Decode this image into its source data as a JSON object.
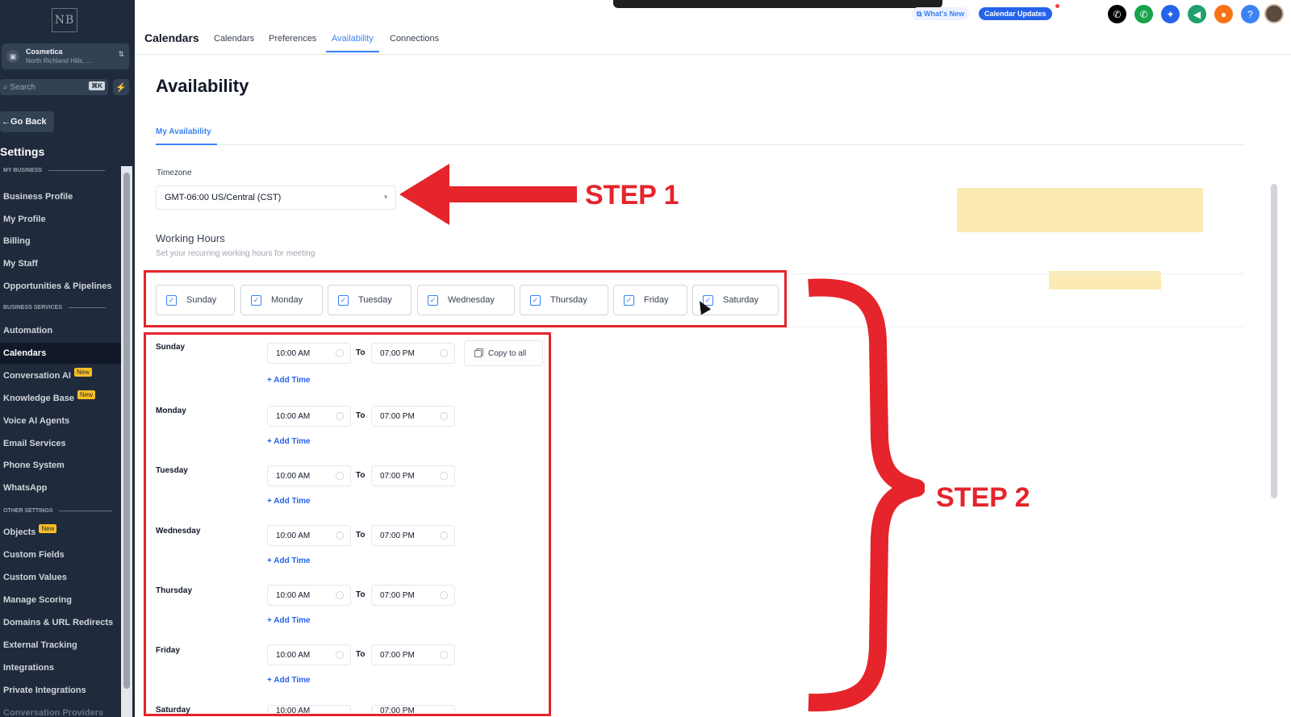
{
  "sidebar": {
    "logo": "NB",
    "account": {
      "name": "Cosmetica",
      "location": "North Richland Hills, ..."
    },
    "search": {
      "placeholder": "Search",
      "shortcut": "⌘K"
    },
    "go_back": "Go Back",
    "title": "Settings",
    "sections": [
      {
        "label": "MY BUSINESS",
        "items": [
          "Business Profile",
          "My Profile",
          "Billing",
          "My Staff",
          "Opportunities & Pipelines"
        ]
      },
      {
        "label": "BUSINESS SERVICES",
        "items": [
          "Automation",
          "Calendars",
          "Conversation AI",
          "Knowledge Base",
          "Voice AI Agents",
          "Email Services",
          "Phone System",
          "WhatsApp"
        ]
      },
      {
        "label": "OTHER SETTINGS",
        "items": [
          "Objects",
          "Custom Fields",
          "Custom Values",
          "Manage Scoring",
          "Domains & URL Redirects",
          "External Tracking",
          "Integrations",
          "Private Integrations",
          "Conversation Providers"
        ]
      }
    ],
    "active_item": "Calendars",
    "new_badge": "New"
  },
  "header": {
    "title": "Calendars",
    "tabs": [
      "Calendars",
      "Preferences",
      "Availability",
      "Connections"
    ],
    "active_tab": "Availability",
    "whats_new": "What's New",
    "calendar_updates": "Calendar Updates",
    "icons": [
      {
        "name": "phone-icon",
        "color": "#000000",
        "glyph": "✆"
      },
      {
        "name": "call-icon",
        "color": "#16a34a",
        "glyph": "✆"
      },
      {
        "name": "magic-icon",
        "color": "#2563eb",
        "glyph": "✦"
      },
      {
        "name": "megaphone-icon",
        "color": "#22a06b",
        "glyph": "◀"
      },
      {
        "name": "bell-icon",
        "color": "#f97316",
        "glyph": "●"
      },
      {
        "name": "help-icon",
        "color": "#3b82f6",
        "glyph": "?"
      }
    ]
  },
  "main": {
    "page_title": "Availability",
    "subtab": "My Availability",
    "timezone_label": "Timezone",
    "timezone_value": "GMT-06:00 US/Central (CST)",
    "working_hours_title": "Working Hours",
    "working_hours_subtitle": "Set your recurring working hours for meeting",
    "days": [
      "Sunday",
      "Monday",
      "Tuesday",
      "Wednesday",
      "Thursday",
      "Friday",
      "Saturday"
    ],
    "schedule": [
      {
        "day": "Sunday",
        "from": "10:00 AM",
        "to": "07:00 PM"
      },
      {
        "day": "Monday",
        "from": "10:00 AM",
        "to": "07:00 PM"
      },
      {
        "day": "Tuesday",
        "from": "10:00 AM",
        "to": "07:00 PM"
      },
      {
        "day": "Wednesday",
        "from": "10:00 AM",
        "to": "07:00 PM"
      },
      {
        "day": "Thursday",
        "from": "10:00 AM",
        "to": "07:00 PM"
      },
      {
        "day": "Friday",
        "from": "10:00 AM",
        "to": "07:00 PM"
      },
      {
        "day": "Saturday",
        "from": "10:00 AM",
        "to": "07:00 PM"
      }
    ],
    "to_label": "To",
    "add_time": "+ Add Time",
    "copy_to_all": "Copy to all"
  },
  "annotations": {
    "step1": "STEP 1",
    "step2": "STEP 2",
    "color": "#e5242b"
  }
}
